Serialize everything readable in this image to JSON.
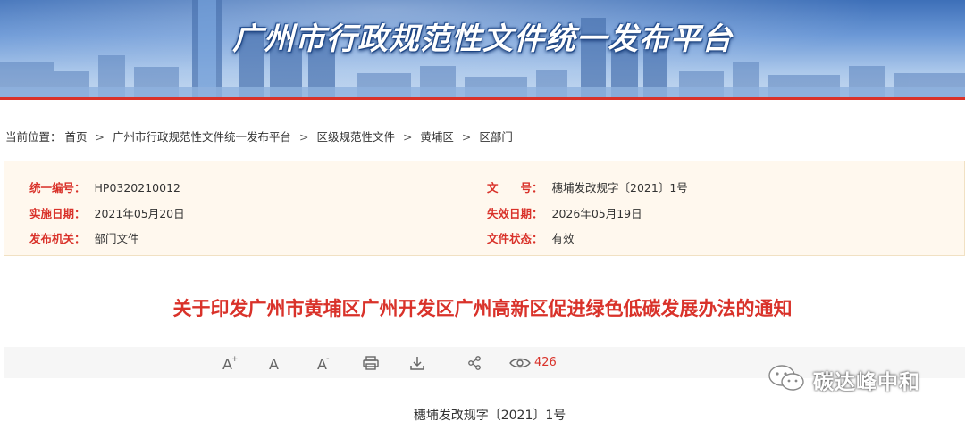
{
  "banner": {
    "title": "广州市行政规范性文件统一发布平台"
  },
  "breadcrumb": {
    "prefix": "当前位置：",
    "items": [
      "首页",
      "广州市行政规范性文件统一发布平台",
      "区级规范性文件",
      "黄埔区",
      "区部门"
    ],
    "separator": ">"
  },
  "info": {
    "serial_label": "统一编号：",
    "serial_value": "HP0320210012",
    "docno_label": "文　　号：",
    "docno_value": "穗埔发改规字〔2021〕1号",
    "effective_label": "实施日期：",
    "effective_value": "2021年05月20日",
    "expire_label": "失效日期：",
    "expire_value": "2026年05月19日",
    "issuer_label": "发布机关：",
    "issuer_value": "部门文件",
    "status_label": "文件状态：",
    "status_value": "有效"
  },
  "document": {
    "title": "关于印发广州市黄埔区广州开发区广州高新区促进绿色低碳发展办法的通知",
    "number": "穗埔发改规字〔2021〕1号"
  },
  "toolbar": {
    "font_large_icon": "font-increase-icon",
    "font_normal_icon": "font-normal-icon",
    "font_small_icon": "font-decrease-icon",
    "print_icon": "print-icon",
    "download_icon": "download-icon",
    "share_icon": "share-icon",
    "view_icon": "eye-icon",
    "view_count": "426"
  },
  "watermark": {
    "text": "碳达峰中和",
    "icon": "wechat-icon"
  },
  "colors": {
    "accent": "#d9322a",
    "info_bg": "#fff8ee",
    "toolbar_bg": "#f6f6f6"
  }
}
